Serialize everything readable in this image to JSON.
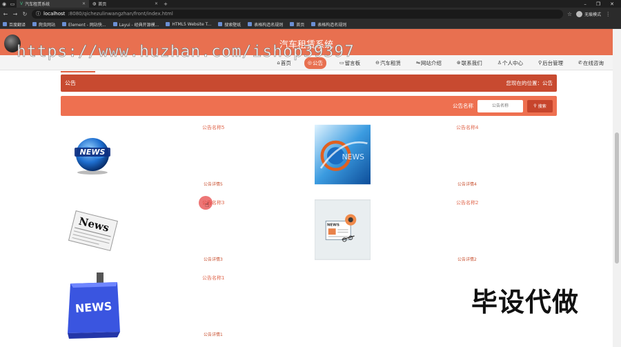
{
  "browser": {
    "tabs": [
      {
        "title": "汽车租赁系统",
        "active": true
      },
      {
        "title": "首页",
        "active": false
      }
    ],
    "url_host": "localhost",
    "url_path": ":8080/qichezulinwangzhan/front/index.html",
    "incognito_label": "无痕模式",
    "bookmarks": [
      "百度翻译",
      "爬虫网站",
      "Element - 网站快...",
      "Layui - 经典开源模...",
      "HTML5 Website T...",
      "搜索壁纸",
      "表格构造名规则",
      "首页",
      "表格构造名规则"
    ]
  },
  "header": {
    "site_title": "汽车租赁系统",
    "watermark": "https://www.huzhan.com/ishop39397"
  },
  "nav": {
    "items": [
      {
        "label": "首页",
        "icon": "home-icon",
        "glyph": "⌂",
        "active": false
      },
      {
        "label": "公告",
        "icon": "notice-icon",
        "glyph": "◎",
        "active": true
      },
      {
        "label": "留言板",
        "icon": "message-icon",
        "glyph": "▭",
        "active": false
      },
      {
        "label": "汽车租赁",
        "icon": "car-icon",
        "glyph": "⊖",
        "active": false
      },
      {
        "label": "网站介绍",
        "icon": "info-icon",
        "glyph": "⇋",
        "active": false
      },
      {
        "label": "联系我们",
        "icon": "contact-icon",
        "glyph": "⊛",
        "active": false
      },
      {
        "label": "个人中心",
        "icon": "user-icon",
        "glyph": "♙",
        "active": false
      },
      {
        "label": "后台管理",
        "icon": "admin-icon",
        "glyph": "⚲",
        "active": false
      },
      {
        "label": "在线咨询",
        "icon": "chat-icon",
        "glyph": "✆",
        "active": false
      }
    ]
  },
  "notice_bar": {
    "title": "公告",
    "location": "您现在的位置：公告"
  },
  "search": {
    "label": "公告名称",
    "placeholder": "公告名称",
    "button": "搜索"
  },
  "notices": [
    {
      "name": "公告名称5",
      "detail": "公告详情5",
      "image": "globe-news"
    },
    {
      "name": "公告名称4",
      "detail": "公告详情4",
      "image": "blue-news"
    },
    {
      "name": "公告名称3",
      "detail": "公告详情3",
      "image": "newspaper"
    },
    {
      "name": "公告名称2",
      "detail": "公告详情2",
      "image": "news-illustration"
    },
    {
      "name": "公告名称1",
      "detail": "公告详情1",
      "image": "news-key"
    }
  ],
  "overlay_text": "毕设代做"
}
